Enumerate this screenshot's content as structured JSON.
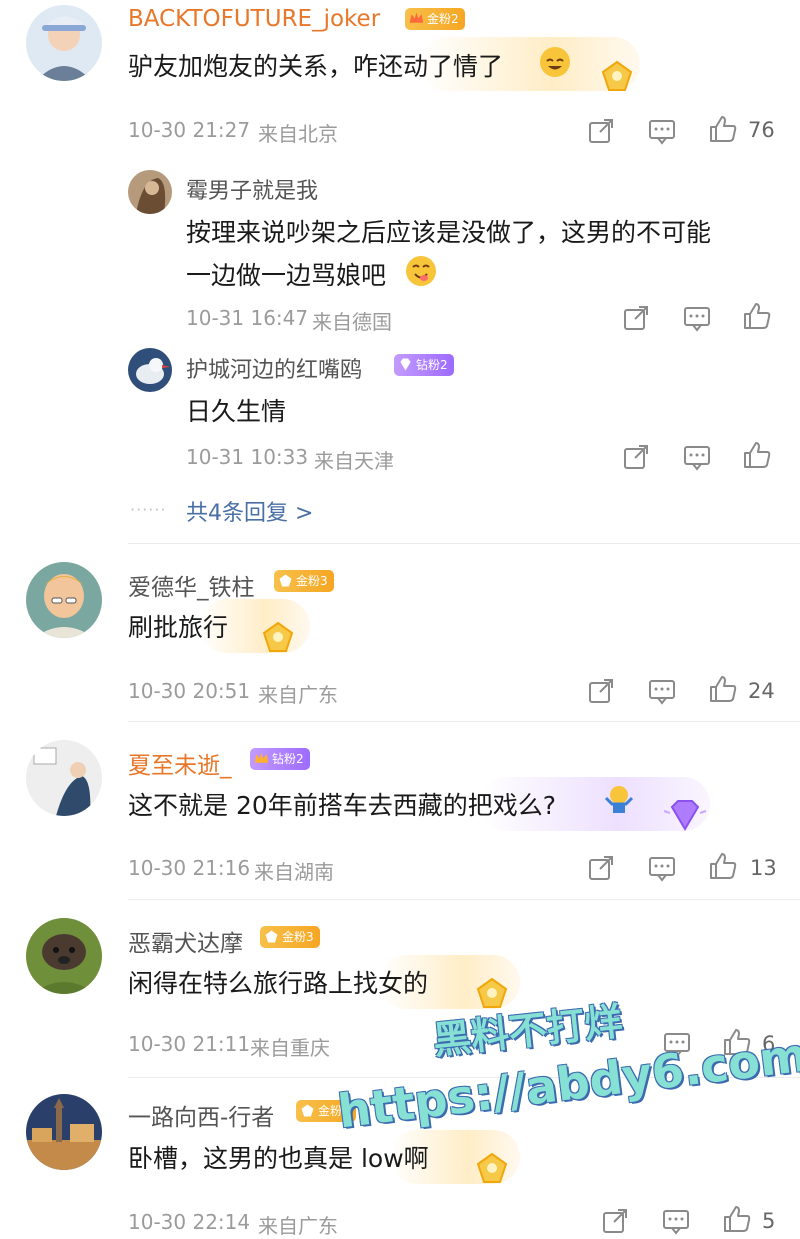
{
  "comments": [
    {
      "user": "BACKTOFUTURE_joker",
      "badge": "金粉2",
      "text": "驴友加炮友的关系，咋还动了情了",
      "time": "10-30 21:27",
      "loc": "来自北京",
      "likes": "76"
    },
    {
      "user": "爱德华_铁柱",
      "badge": "金粉3",
      "text": "刷批旅行",
      "time": "10-30 20:51",
      "loc": "来自广东",
      "likes": "24"
    },
    {
      "user": "夏至未逝_",
      "badge": "钻粉2",
      "text": "这不就是 20年前搭车去西藏的把戏么?",
      "time": "10-30 21:16",
      "loc": "来自湖南",
      "likes": "13"
    },
    {
      "user": "恶霸犬达摩",
      "badge": "金粉3",
      "text": "闲得在特么旅行路上找女的",
      "time": "10-30 21:11",
      "loc": "来自重庆",
      "likes": "6"
    },
    {
      "user": "一路向西-行者",
      "badge": "金粉4",
      "text": "卧槽，这男的也真是 low啊",
      "time": "10-30 22:14",
      "loc": "来自广东",
      "likes": "5"
    }
  ],
  "replies": [
    {
      "user": "霉男子就是我",
      "text_line1": "按理来说吵架之后应该是没做了，这男的不可能",
      "text_line2": "一边做一边骂娘吧",
      "time": "10-31 16:47",
      "loc": "来自德国"
    },
    {
      "user": "护城河边的红嘴鸥",
      "badge": "钻粉2",
      "text": "日久生情",
      "time": "10-31 10:33",
      "loc": "来自天津"
    }
  ],
  "more_replies": "共4条回复 >",
  "more_dots": "······",
  "watermark": {
    "line1": "黑料不打烊",
    "line2": "https://abdy6.com"
  },
  "colors": {
    "orange_name": "#e8772a",
    "gold_badge": "#f6a623",
    "diamond_badge": "#9d6bff",
    "link": "#4a6fa5",
    "meta": "#9b9b9b"
  }
}
